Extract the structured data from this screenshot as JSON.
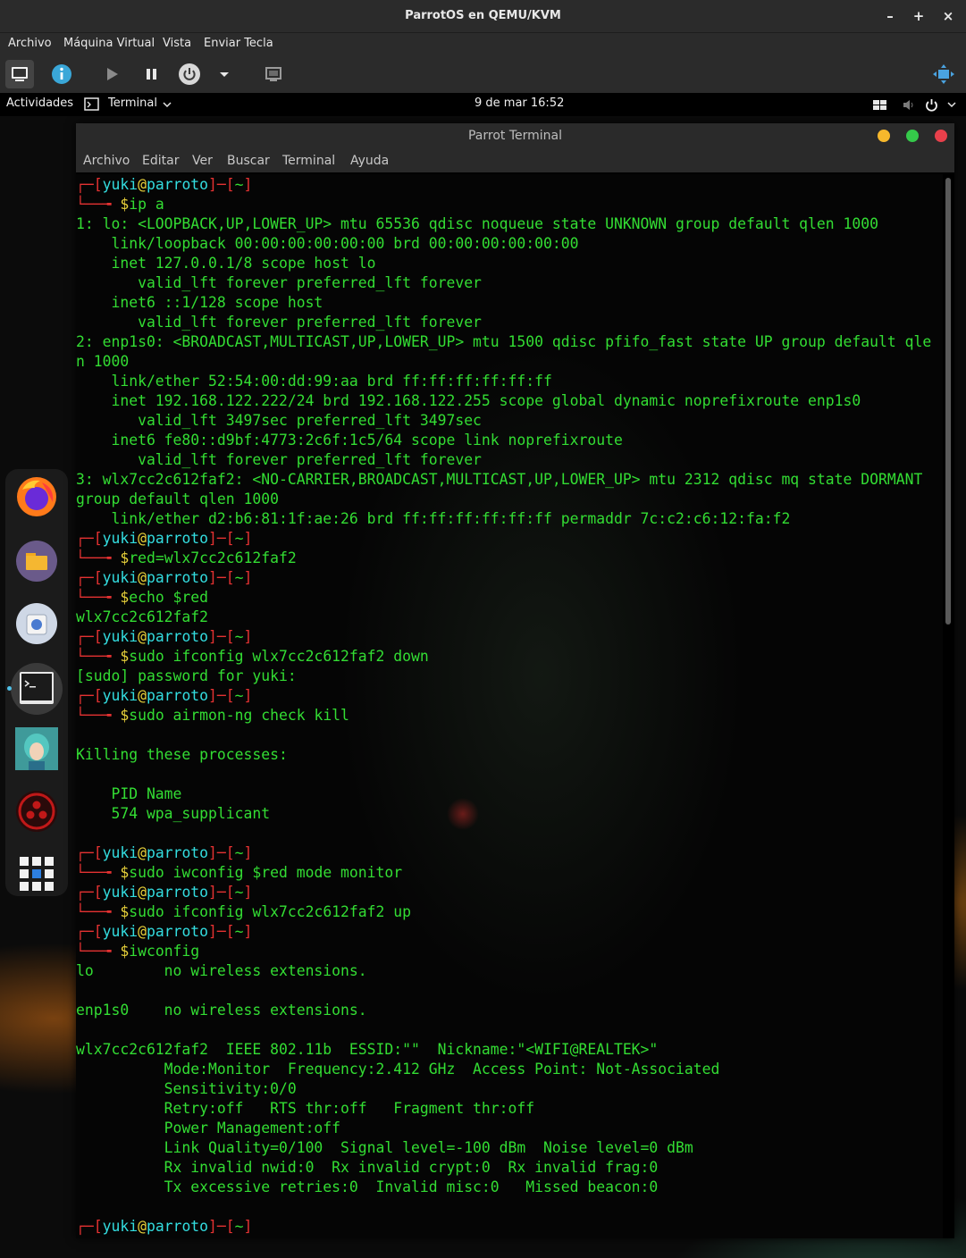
{
  "window": {
    "title": "ParrotOS en QEMU/KVM",
    "menu": [
      "Archivo",
      "Máquina Virtual",
      "Vista",
      "Enviar Tecla"
    ]
  },
  "gnome_bar": {
    "activities": "Actividades",
    "app": "Terminal",
    "clock": "9 de mar  16:52"
  },
  "terminal": {
    "title": "Parrot Terminal",
    "menu": [
      "Archivo",
      "Editar",
      "Ver",
      "Buscar",
      "Terminal",
      "Ayuda"
    ],
    "prompt": {
      "user": "yuki",
      "at": "@",
      "host": "parroto",
      "dir": "~"
    },
    "lines": [
      {
        "kind": "p1"
      },
      {
        "kind": "p2",
        "text": "ip a"
      },
      {
        "kind": "o",
        "text": "1: lo: <LOOPBACK,UP,LOWER_UP> mtu 65536 qdisc noqueue state UNKNOWN group default qlen 1000"
      },
      {
        "kind": "o",
        "text": "    link/loopback 00:00:00:00:00:00 brd 00:00:00:00:00:00"
      },
      {
        "kind": "o",
        "text": "    inet 127.0.0.1/8 scope host lo"
      },
      {
        "kind": "o",
        "text": "       valid_lft forever preferred_lft forever"
      },
      {
        "kind": "o",
        "text": "    inet6 ::1/128 scope host"
      },
      {
        "kind": "o",
        "text": "       valid_lft forever preferred_lft forever"
      },
      {
        "kind": "o",
        "text": "2: enp1s0: <BROADCAST,MULTICAST,UP,LOWER_UP> mtu 1500 qdisc pfifo_fast state UP group default qle"
      },
      {
        "kind": "o",
        "text": "n 1000"
      },
      {
        "kind": "o",
        "text": "    link/ether 52:54:00:dd:99:aa brd ff:ff:ff:ff:ff:ff"
      },
      {
        "kind": "o",
        "text": "    inet 192.168.122.222/24 brd 192.168.122.255 scope global dynamic noprefixroute enp1s0"
      },
      {
        "kind": "o",
        "text": "       valid_lft 3497sec preferred_lft 3497sec"
      },
      {
        "kind": "o",
        "text": "    inet6 fe80::d9bf:4773:2c6f:1c5/64 scope link noprefixroute"
      },
      {
        "kind": "o",
        "text": "       valid_lft forever preferred_lft forever"
      },
      {
        "kind": "o",
        "text": "3: wlx7cc2c612faf2: <NO-CARRIER,BROADCAST,MULTICAST,UP,LOWER_UP> mtu 2312 qdisc mq state DORMANT"
      },
      {
        "kind": "o",
        "text": "group default qlen 1000"
      },
      {
        "kind": "o",
        "text": "    link/ether d2:b6:81:1f:ae:26 brd ff:ff:ff:ff:ff:ff permaddr 7c:c2:c6:12:fa:f2"
      },
      {
        "kind": "p1"
      },
      {
        "kind": "p2",
        "text": "red=wlx7cc2c612faf2"
      },
      {
        "kind": "p1"
      },
      {
        "kind": "p2",
        "text": "echo $red"
      },
      {
        "kind": "o",
        "text": "wlx7cc2c612faf2"
      },
      {
        "kind": "p1"
      },
      {
        "kind": "p2",
        "text": "sudo ifconfig wlx7cc2c612faf2 down"
      },
      {
        "kind": "o",
        "text": "[sudo] password for yuki:"
      },
      {
        "kind": "p1"
      },
      {
        "kind": "p2",
        "text": "sudo airmon-ng check kill"
      },
      {
        "kind": "o",
        "text": ""
      },
      {
        "kind": "o",
        "text": "Killing these processes:"
      },
      {
        "kind": "o",
        "text": ""
      },
      {
        "kind": "o",
        "text": "    PID Name"
      },
      {
        "kind": "o",
        "text": "    574 wpa_supplicant"
      },
      {
        "kind": "o",
        "text": ""
      },
      {
        "kind": "p1"
      },
      {
        "kind": "p2",
        "text": "sudo iwconfig $red mode monitor"
      },
      {
        "kind": "p1"
      },
      {
        "kind": "p2",
        "text": "sudo ifconfig wlx7cc2c612faf2 up"
      },
      {
        "kind": "p1"
      },
      {
        "kind": "p2",
        "text": "iwconfig"
      },
      {
        "kind": "o",
        "text": "lo        no wireless extensions."
      },
      {
        "kind": "o",
        "text": ""
      },
      {
        "kind": "o",
        "text": "enp1s0    no wireless extensions."
      },
      {
        "kind": "o",
        "text": ""
      },
      {
        "kind": "o",
        "text": "wlx7cc2c612faf2  IEEE 802.11b  ESSID:\"\"  Nickname:\"<WIFI@REALTEK>\""
      },
      {
        "kind": "o",
        "text": "          Mode:Monitor  Frequency:2.412 GHz  Access Point: Not-Associated"
      },
      {
        "kind": "o",
        "text": "          Sensitivity:0/0"
      },
      {
        "kind": "o",
        "text": "          Retry:off   RTS thr:off   Fragment thr:off"
      },
      {
        "kind": "o",
        "text": "          Power Management:off"
      },
      {
        "kind": "o",
        "text": "          Link Quality=0/100  Signal level=-100 dBm  Noise level=0 dBm"
      },
      {
        "kind": "o",
        "text": "          Rx invalid nwid:0  Rx invalid crypt:0  Rx invalid frag:0"
      },
      {
        "kind": "o",
        "text": "          Tx excessive retries:0  Invalid misc:0   Missed beacon:0"
      },
      {
        "kind": "o",
        "text": ""
      },
      {
        "kind": "p1"
      }
    ]
  }
}
